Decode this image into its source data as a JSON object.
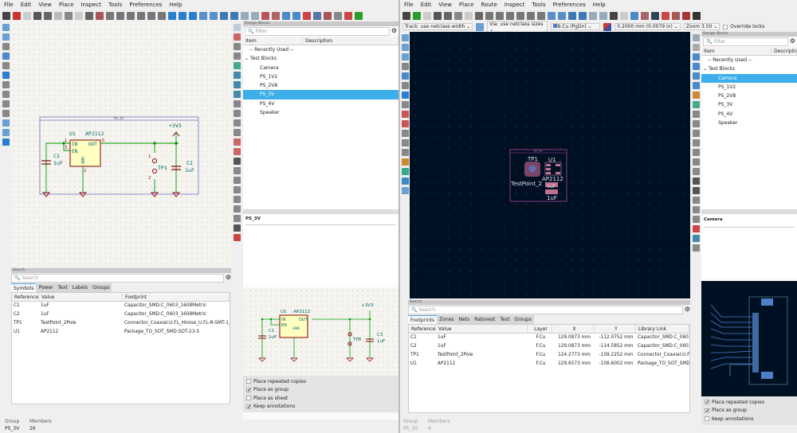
{
  "schematic": {
    "menu": [
      "File",
      "Edit",
      "View",
      "Place",
      "Inspect",
      "Tools",
      "Preferences",
      "Help"
    ],
    "sheet_label": "PS_3V",
    "symbols": {
      "u1_ref": "U1",
      "u1_value": "AP2112",
      "pin_in": "IN",
      "pin_en": "EN",
      "pin_out": "OUT",
      "pin_gnd": "GND",
      "n1": "1",
      "n3": "3",
      "n5": "5",
      "n2": "2",
      "c1_ref": "C1",
      "c1_value": "1uF",
      "c2_ref": "C2",
      "c2_value": "1uF",
      "tp1_ref": "TP1",
      "power": "+3V3",
      "tp_n1": "1",
      "tp_n2": "2"
    },
    "design_blocks": {
      "title": "Design Blocks",
      "filter_placeholder": "Filter",
      "col_item": "Item",
      "col_description": "Description",
      "recent": "-- Recently Used --",
      "group": "Test Blocks",
      "items": [
        "Camera",
        "PS_1V2",
        "PS_2V8",
        "PS_3V",
        "PS_4V",
        "Speaker"
      ],
      "selected": "PS_3V",
      "preview_title": "PS_3V",
      "preview": {
        "u1_ref": "U1",
        "u1_value": "AP2112",
        "pin_in": "IN",
        "pin_en": "EN",
        "pin_out": "OUT",
        "pin_gnd": "GND",
        "c1_ref": "C1",
        "c1_value": "1uF",
        "c3_ref": "C3",
        "c3_value": "1uF",
        "tp_ref": "TP8",
        "power": "+3V3"
      },
      "options": [
        {
          "label": "Place repeated copies",
          "checked": false
        },
        {
          "label": "Place as group",
          "checked": true
        },
        {
          "label": "Place as sheet",
          "checked": false
        },
        {
          "label": "Keep annotations",
          "checked": true
        }
      ]
    },
    "search": {
      "title": "Search",
      "placeholder": "Search",
      "tabs": [
        "Symbols",
        "Power",
        "Text",
        "Labels",
        "Groups"
      ],
      "active_tab": "Symbols",
      "columns": [
        "Reference",
        "Value",
        "Footprint"
      ],
      "rows": [
        [
          "C1",
          "1uF",
          "Capacitor_SMD:C_0603_1608Metric"
        ],
        [
          "C2",
          "1uF",
          "Capacitor_SMD:C_0603_1608Metric"
        ],
        [
          "TP1",
          "TestPoint_2Pole",
          "Connector_Coaxial:U.FL_Hirose_U.FL-R-SMT-1_Ver"
        ],
        [
          "U1",
          "AP2112",
          "Package_TO_SOT_SMD:SOT-23-5"
        ]
      ]
    },
    "status": {
      "group_label": "Group",
      "group_value": "PS_3V",
      "members_label": "Members",
      "members_value": "26"
    }
  },
  "pcb": {
    "menu": [
      "File",
      "Edit",
      "View",
      "Place",
      "Route",
      "Inspect",
      "Tools",
      "Preferences",
      "Help"
    ],
    "track": "Track: use netclass width",
    "via": "Via: use netclass sizes",
    "layer": "B.Cu (PgDn)",
    "grid": "0.2000 mm (0.0079 in)",
    "zoom": "Zoom 3.50",
    "override_locks": "Override locks",
    "board": {
      "group_label": "PS_3V",
      "tp1": "TP1",
      "u1": "U1",
      "tp_value": "TestPoint_2",
      "u1_value": "AP2112",
      "c_value1": "1uF",
      "c_value2": "1uF"
    },
    "design_blocks": {
      "title": "Design Blocks",
      "filter_placeholder": "Filter",
      "col_item": "Item",
      "col_description": "Description",
      "recent": "-- Recently Used --",
      "group": "Test Blocks",
      "items": [
        "Camera",
        "PS_1V2",
        "PS_2V8",
        "PS_3V",
        "PS_4V",
        "Speaker"
      ],
      "selected": "Camera",
      "preview_title": "Camera",
      "options": [
        {
          "label": "Place repeated copies",
          "checked": true
        },
        {
          "label": "Place as group",
          "checked": true
        },
        {
          "label": "Keep annotations",
          "checked": false
        }
      ]
    },
    "search": {
      "title": "Search",
      "placeholder": "Search",
      "tabs": [
        "Footprints",
        "Zones",
        "Nets",
        "Ratsnest",
        "Text",
        "Groups"
      ],
      "active_tab": "Footprints",
      "columns": [
        "Reference",
        "Value",
        "Layer",
        "X",
        "Y",
        "Library Link"
      ],
      "rows": [
        [
          "C1",
          "1uF",
          "F.Cu",
          "129.0873 mm",
          "-112.0752 mm",
          "Capacitor_SMD:C_0603_16"
        ],
        [
          "C2",
          "1uF",
          "F.Cu",
          "129.0873 mm",
          "-114.5852 mm",
          "Capacitor_SMD:C_0603_16"
        ],
        [
          "TP1",
          "TestPoint_2Pole",
          "F.Cu",
          "124.2773 mm",
          "-109.2252 mm",
          "Connector_Coaxial:U.FL_H"
        ],
        [
          "U1",
          "AP2112",
          "F.Cu",
          "129.6573 mm",
          "-108.6002 mm",
          "Package_TO_SOT_SMD:SO"
        ]
      ]
    },
    "status": {
      "group_label": "Group",
      "group_value": "PS_3V",
      "members_label": "Members",
      "members_value": "4"
    }
  },
  "colors": {
    "accent": "#3daee9",
    "wire": "#009900",
    "symbol": "#840000",
    "symbol_fill": "#ffffc2",
    "pcb_bg": "#001023"
  }
}
